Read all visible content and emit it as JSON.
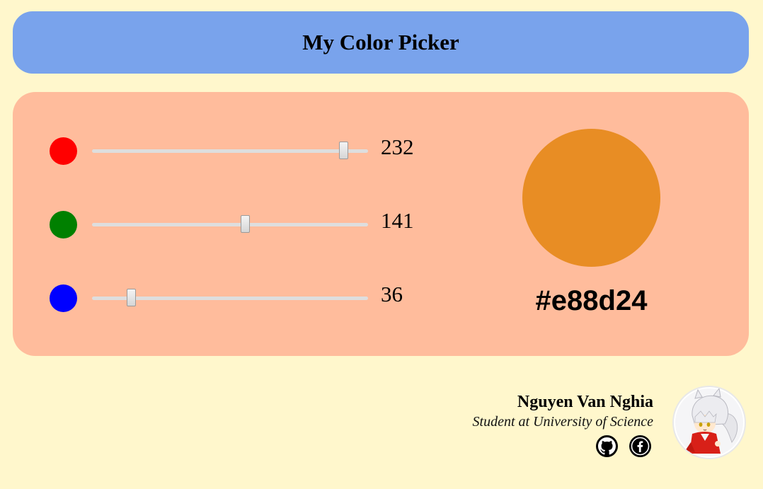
{
  "header": {
    "title": "My Color Picker"
  },
  "colors": {
    "page_bg": "#fff7cc",
    "header_bg": "#79a3ec",
    "panel_bg": "#ffbc9c",
    "red_dot": "#ff0000",
    "green_dot": "#008000",
    "blue_dot": "#0000ff"
  },
  "sliders": [
    {
      "channel": "red",
      "value": "232",
      "fraction": 0.91
    },
    {
      "channel": "green",
      "value": "141",
      "fraction": 0.553
    },
    {
      "channel": "blue",
      "value": "36",
      "fraction": 0.141
    }
  ],
  "preview": {
    "color": "#e88d24",
    "hex_label": "#e88d24"
  },
  "author": {
    "name": "Nguyen Van Nghia",
    "role": "Student at University of Science"
  },
  "social": {
    "github_icon": "github-icon",
    "facebook_icon": "facebook-icon"
  }
}
